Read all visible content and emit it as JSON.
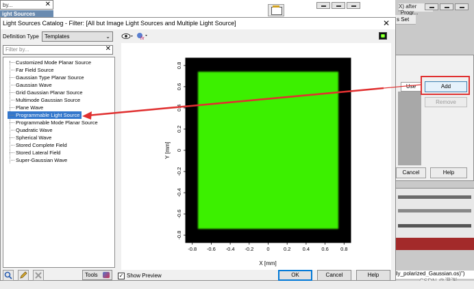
{
  "background": {
    "filter_top": "by...",
    "sources_top": "ight Sources",
    "title_sliver": "X) after \"Progr...",
    "set_sliver": "s Set",
    "use_header": "Use",
    "add_label": "Add",
    "remove_label": "Remove",
    "cancel_label": "Cancel",
    "help_label": "Help",
    "bottom_text": "lly_polarized_Gaussian.os)\")",
    "watermark": "CSDN @澄渊",
    "highlight_color": "#e03030"
  },
  "dialog": {
    "title": "Light Sources Catalog - Filter: [All but Image Light Sources and Multiple Light Source]",
    "close_glyph": "✕",
    "definition_type_label": "Definition Type",
    "definition_type_value": "Templates",
    "filter_placeholder": "Filter by...",
    "filter_clear_glyph": "✕",
    "tree_items": [
      "Customized Mode Planar Source",
      "Far Field Source",
      "Gaussian Type Planar Source",
      "Gaussian Wave",
      "Grid Gaussian Planar Source",
      "Multimode Gaussian Source",
      "Plane Wave",
      "Programmable Light Source",
      "Programmable Mode Planar Source",
      "Quadratic Wave",
      "Spherical Wave",
      "Stored Complete Field",
      "Stored Lateral Field",
      "Super-Gaussian Wave"
    ],
    "selected_item": "Programmable Light Source",
    "tools_label": "Tools",
    "show_preview_label": "Show Preview",
    "show_preview_checked": "✓",
    "ok_label": "OK",
    "cancel_label": "Cancel",
    "help_label": "Help",
    "bottom_icons": [
      "search-icon",
      "edit-icon",
      "delete-icon"
    ]
  },
  "preview": {
    "xlabel": "X [mm]",
    "ylabel": "Y [mm]",
    "x_ticks": [
      "-0.8",
      "-0.6",
      "-0.4",
      "-0.2",
      "0",
      "0.2",
      "0.4",
      "0.6",
      "0.8"
    ],
    "y_ticks": [
      "0.8",
      "0.6",
      "0.4",
      "0.2",
      "0",
      "-0.2",
      "-0.4",
      "-0.6",
      "-0.8"
    ],
    "field_color": "#3cf000",
    "background_color": "#000000"
  }
}
